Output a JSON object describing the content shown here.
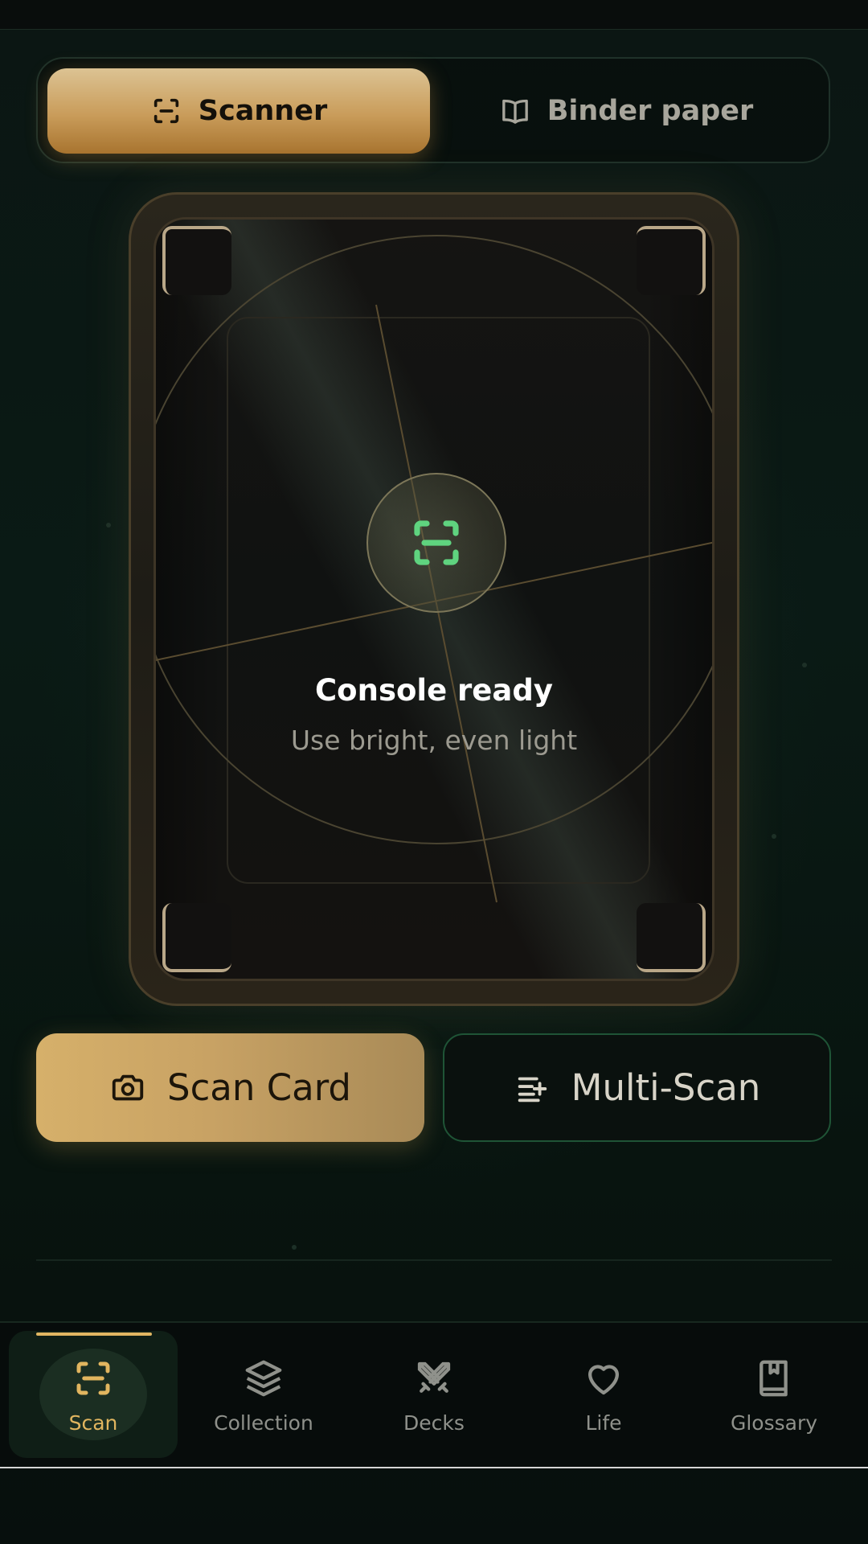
{
  "mode_toggle": {
    "options": [
      {
        "label": "Scanner",
        "icon": "scan-frame-icon",
        "active": true
      },
      {
        "label": "Binder paper",
        "icon": "open-book-icon",
        "active": false
      }
    ]
  },
  "scanner": {
    "status_icon": "scan-frame-icon",
    "title": "Console ready",
    "hint": "Use bright, even light"
  },
  "actions": {
    "primary": {
      "label": "Scan Card",
      "icon": "camera-icon"
    },
    "secondary": {
      "label": "Multi-Scan",
      "icon": "list-add-icon"
    }
  },
  "bottom_nav": {
    "active": "Scan",
    "items": [
      {
        "label": "Scan",
        "icon": "scan-frame-icon"
      },
      {
        "label": "Collection",
        "icon": "layers-icon"
      },
      {
        "label": "Decks",
        "icon": "crossed-swords-icon"
      },
      {
        "label": "Life",
        "icon": "heart-icon"
      },
      {
        "label": "Glossary",
        "icon": "bookmark-book-icon"
      }
    ]
  },
  "colors": {
    "accent_gold": "#d6b06a",
    "scan_green": "#5fd37f",
    "background": "#07120f"
  }
}
